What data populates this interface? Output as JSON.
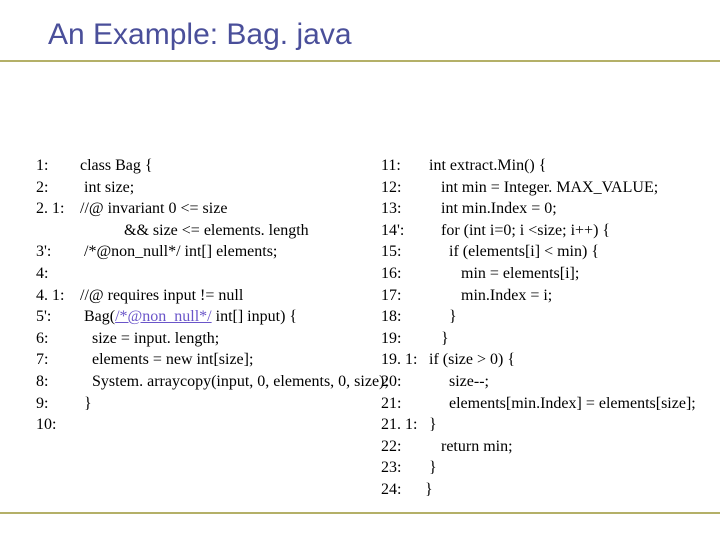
{
  "title": "An Example: Bag. java",
  "left": {
    "lines": [
      {
        "ln": "1:",
        "before": " class Bag {",
        "hl": "",
        "after": ""
      },
      {
        "ln": "2:",
        "before": "  int size;",
        "hl": "",
        "after": ""
      },
      {
        "ln": "2. 1:",
        "before": " //@ invariant 0 <= size",
        "hl": "",
        "after": ""
      },
      {
        "ln": "",
        "before": "            && size <= elements. length",
        "hl": "",
        "after": ""
      },
      {
        "ln": "3':",
        "before": "  /*@non_null*/ int[] elements;",
        "hl": "",
        "after": ""
      },
      {
        "ln": "4:",
        "before": "",
        "hl": "",
        "after": ""
      },
      {
        "ln": "4. 1:",
        "before": " //@ requires input != null",
        "hl": "",
        "after": ""
      },
      {
        "ln": "5':",
        "before": "  Bag(",
        "hl": "/*@non_null*/",
        "after": " int[] input) {"
      },
      {
        "ln": "6:",
        "before": "    size = input. length;",
        "hl": "",
        "after": ""
      },
      {
        "ln": "7:",
        "before": "    elements = new int[size];",
        "hl": "",
        "after": ""
      },
      {
        "ln": "8:",
        "before": "    System. arraycopy(input, 0, elements, 0, size);",
        "hl": "",
        "after": ""
      },
      {
        "ln": "9:",
        "before": "  }",
        "hl": "",
        "after": ""
      },
      {
        "ln": "10:",
        "before": "",
        "hl": "",
        "after": ""
      }
    ]
  },
  "right": {
    "lines": [
      {
        "ln": "11:",
        "before": "  int extract.Min() {",
        "hl": "",
        "after": ""
      },
      {
        "ln": "12:",
        "before": "     int min = Integer. MAX_VALUE;",
        "hl": "",
        "after": ""
      },
      {
        "ln": "13:",
        "before": "     int min.Index = 0;",
        "hl": "",
        "after": ""
      },
      {
        "ln": "14':",
        "before": "     for (int i=0; i <size; i++) {",
        "hl": "",
        "after": ""
      },
      {
        "ln": "15:",
        "before": "       if (elements[i] < min) {",
        "hl": "",
        "after": ""
      },
      {
        "ln": "16:",
        "before": "          min = elements[i];",
        "hl": "",
        "after": ""
      },
      {
        "ln": "17:",
        "before": "          min.Index = i;",
        "hl": "",
        "after": ""
      },
      {
        "ln": "18:",
        "before": "       }",
        "hl": "",
        "after": ""
      },
      {
        "ln": "19:",
        "before": "     }",
        "hl": "",
        "after": ""
      },
      {
        "ln": "19. 1:",
        "before": "  if (size > 0) {",
        "hl": "",
        "after": ""
      },
      {
        "ln": "20:",
        "before": "       size--;",
        "hl": "",
        "after": ""
      },
      {
        "ln": "21:",
        "before": "       elements[min.Index] = elements[size];",
        "hl": "",
        "after": ""
      },
      {
        "ln": "21. 1:",
        "before": "  }",
        "hl": "",
        "after": ""
      },
      {
        "ln": "22:",
        "before": "     return min;",
        "hl": "",
        "after": ""
      },
      {
        "ln": "23:",
        "before": "  }",
        "hl": "",
        "after": ""
      },
      {
        "ln": "24:",
        "before": " }",
        "hl": "",
        "after": ""
      }
    ]
  }
}
